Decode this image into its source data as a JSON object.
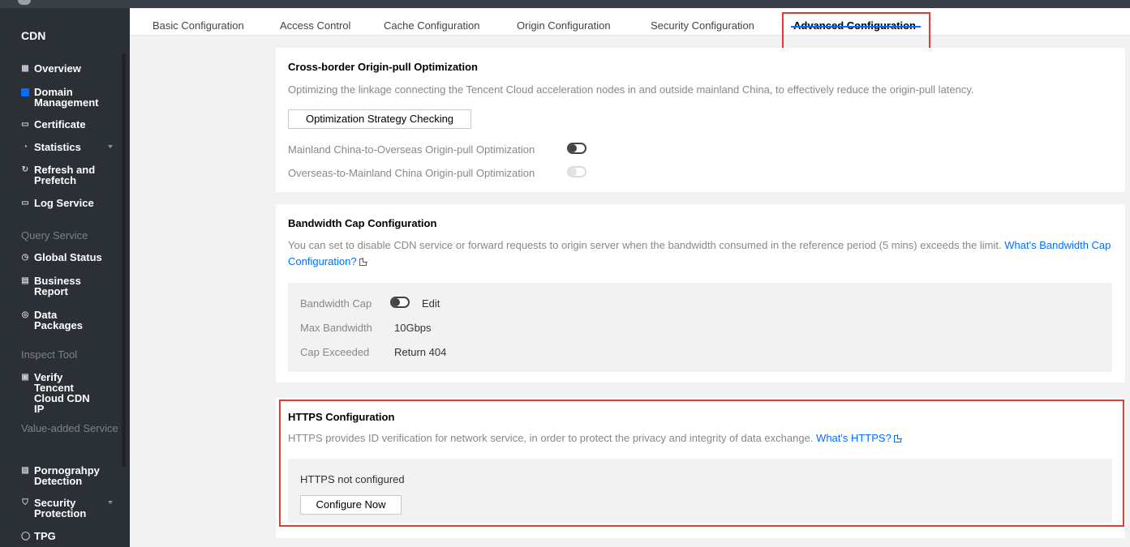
{
  "sidebar": {
    "brand": "CDN",
    "items": [
      {
        "label": "Overview",
        "icon": "grid-icon"
      },
      {
        "label": "Domain Management",
        "icon": "domain-icon",
        "active": true
      },
      {
        "label": "Certificate",
        "icon": "certificate-icon"
      },
      {
        "label": "Statistics",
        "icon": "pie-chart-icon",
        "has_submenu": true
      },
      {
        "label": "Refresh and Prefetch",
        "icon": "refresh-icon"
      },
      {
        "label": "Log Service",
        "icon": "folder-icon"
      }
    ],
    "group_query": "Query Service",
    "query_items": [
      {
        "label": "Global Status",
        "icon": "clock-icon"
      },
      {
        "label": "Business Report",
        "icon": "report-icon"
      },
      {
        "label": "Data Packages",
        "icon": "package-icon"
      }
    ],
    "group_inspect": "Inspect Tool",
    "inspect_items": [
      {
        "label": "Verify Tencent Cloud CDN IP",
        "icon": "ip-icon"
      }
    ],
    "group_value": "Value-added Service",
    "value_items": [
      {
        "label": "Pornograhpy Detection",
        "icon": "image-icon"
      },
      {
        "label": "Security Protection",
        "icon": "shield-icon",
        "has_submenu": true
      },
      {
        "label": "TPG",
        "icon": "circle-icon"
      }
    ]
  },
  "tabs": [
    {
      "label": "Basic Configuration"
    },
    {
      "label": "Access Control"
    },
    {
      "label": "Cache Configuration"
    },
    {
      "label": "Origin Configuration"
    },
    {
      "label": "Security Configuration"
    },
    {
      "label": "Advanced Configuration",
      "active": true
    }
  ],
  "cross_border": {
    "title": "Cross-border Origin-pull Optimization",
    "description": "Optimizing the linkage connecting the Tencent Cloud acceleration nodes in and outside mainland China, to effectively reduce the origin-pull latency.",
    "button": "Optimization Strategy Checking",
    "toggle1_label": "Mainland China-to-Overseas Origin-pull Optimization",
    "toggle1_state": "off",
    "toggle2_label": "Overseas-to-Mainland China Origin-pull Optimization",
    "toggle2_state": "disabled"
  },
  "bandwidth": {
    "title": "Bandwidth Cap Configuration",
    "description": "You can set to disable CDN service or forward requests to origin server when the bandwidth consumed in the reference period (5 mins) exceeds the limit.",
    "link_part1": "What's",
    "link_part2": "Bandwidth Cap Configuration?",
    "cap_label": "Bandwidth Cap",
    "cap_state": "off",
    "edit": "Edit",
    "max_label": "Max Bandwidth",
    "max_value": "10Gbps",
    "exceeded_label": "Cap Exceeded",
    "exceeded_value": "Return 404"
  },
  "https": {
    "title": "HTTPS Configuration",
    "description": "HTTPS provides ID verification for network service, in order to protect the privacy and integrity of data exchange.",
    "link": "What's HTTPS?",
    "status": "HTTPS not configured",
    "button": "Configure Now"
  },
  "colors": {
    "accent": "#006eff",
    "highlight": "#e53935",
    "sidebar": "#2b2f36"
  }
}
